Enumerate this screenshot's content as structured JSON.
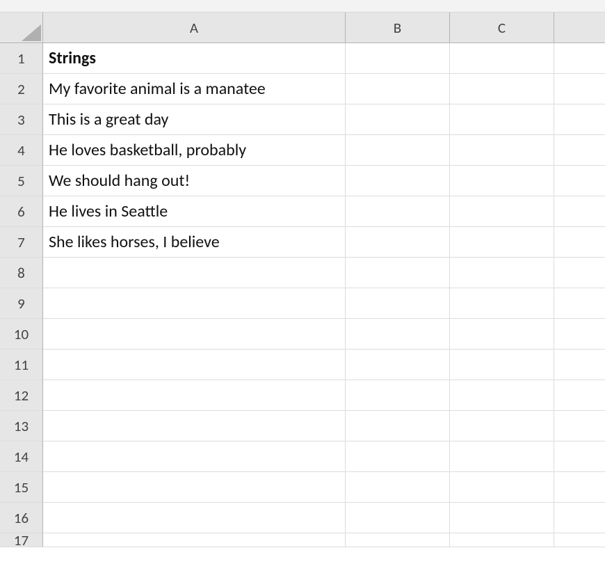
{
  "columns": [
    "A",
    "B",
    "C",
    ""
  ],
  "rows": [
    "1",
    "2",
    "3",
    "4",
    "5",
    "6",
    "7",
    "8",
    "9",
    "10",
    "11",
    "12",
    "13",
    "14",
    "15",
    "16",
    "17"
  ],
  "cells": {
    "A1": {
      "value": "Strings",
      "bold": true
    },
    "A2": {
      "value": "My favorite animal is a manatee"
    },
    "A3": {
      "value": "This is a great day"
    },
    "A4": {
      "value": "He loves basketball, probably"
    },
    "A5": {
      "value": "We should hang out!"
    },
    "A6": {
      "value": "He lives in Seattle"
    },
    "A7": {
      "value": "She likes horses, I believe"
    }
  }
}
